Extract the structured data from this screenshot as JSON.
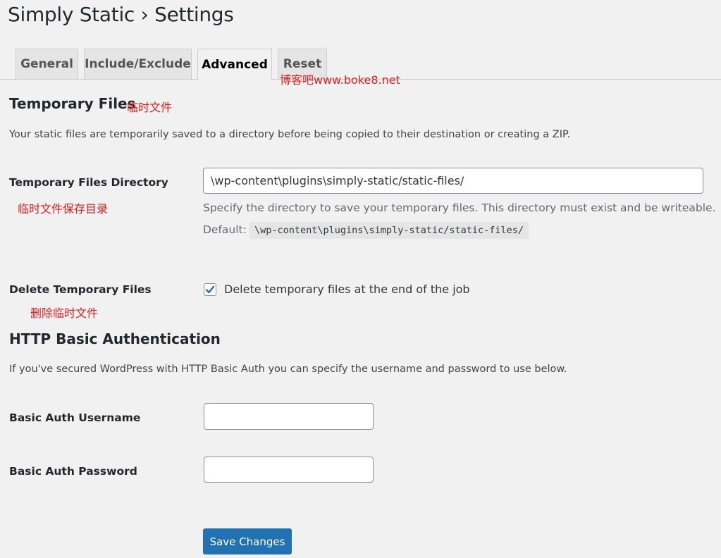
{
  "page": {
    "title": "Simply Static › Settings"
  },
  "tabs": [
    {
      "label": "General"
    },
    {
      "label": "Include/Exclude"
    },
    {
      "label": "Advanced"
    },
    {
      "label": "Reset"
    }
  ],
  "watermark": {
    "site": "博客吧www.boke8.net"
  },
  "temporary_files": {
    "heading": "Temporary Files",
    "heading_note": "临时文件",
    "description": "Your static files are temporarily saved to a directory before being copied to their destination or creating a ZIP.",
    "directory_label": "Temporary Files Directory",
    "directory_note": "临时文件保存目录",
    "directory_value": "\\wp-content\\plugins\\simply-static/static-files/",
    "directory_hint": "Specify the directory to save your temporary files. This directory must exist and be writeable.",
    "default_label": "Default:",
    "default_value": "\\wp-content\\plugins\\simply-static/static-files/",
    "delete_label": "Delete Temporary Files",
    "delete_note": "删除临时文件",
    "delete_checkbox_label": "Delete temporary files at the end of the job",
    "delete_checked": true
  },
  "http_auth": {
    "heading": "HTTP Basic Authentication",
    "description": "If you've secured WordPress with HTTP Basic Auth you can specify the username and password to use below.",
    "username_label": "Basic Auth Username",
    "username_value": "",
    "password_label": "Basic Auth Password",
    "password_value": ""
  },
  "actions": {
    "save_label": "Save Changes"
  },
  "colors": {
    "primary": "#2271b1",
    "watermark": "#e02020",
    "background": "#f1f1f1"
  }
}
